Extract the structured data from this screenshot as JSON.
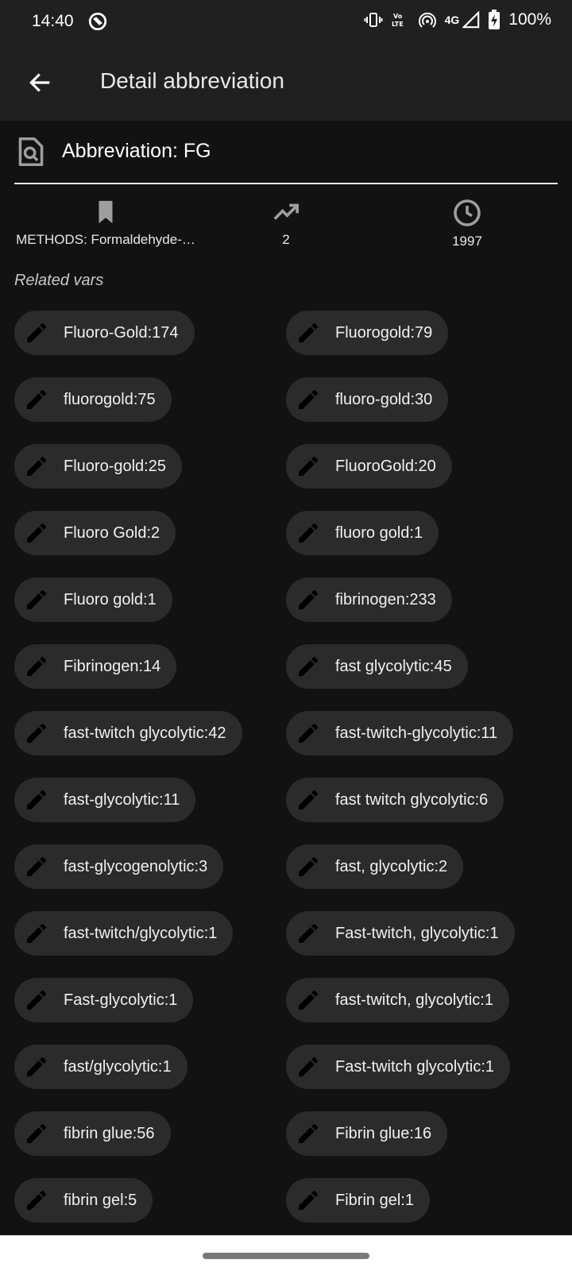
{
  "status_bar": {
    "time": "14:40",
    "network": "4G",
    "volte": "Vo LTE",
    "battery": "100%",
    "icons": [
      "app-notification-icon",
      "vibrate-icon",
      "volte-icon",
      "hotspot-icon",
      "signal-icon",
      "battery-charging-icon"
    ]
  },
  "app_bar": {
    "title": "Detail abbreviation",
    "back_icon": "arrow-left-icon"
  },
  "abbreviation": {
    "label": "Abbreviation: FG",
    "icon": "find-in-page-icon"
  },
  "stats": {
    "category": "METHODS: Formaldehyde-…",
    "category_icon": "bookmark-icon",
    "trend": "2",
    "trend_icon": "trending-up-icon",
    "year": "1997",
    "year_icon": "clock-icon"
  },
  "related": {
    "label": "Related vars",
    "chip_icon": "pencil-icon",
    "items": [
      "Fluoro-Gold:174",
      "Fluorogold:79",
      "fluorogold:75",
      "fluoro-gold:30",
      "Fluoro-gold:25",
      "FluoroGold:20",
      "Fluoro Gold:2",
      "fluoro gold:1",
      "Fluoro gold:1",
      "fibrinogen:233",
      "Fibrinogen:14",
      "fast glycolytic:45",
      "fast-twitch glycolytic:42",
      "fast-twitch-glycolytic:11",
      "fast-glycolytic:11",
      "fast twitch glycolytic:6",
      "fast-glycogenolytic:3",
      "fast, glycolytic:2",
      "fast-twitch/glycolytic:1",
      "Fast-twitch, glycolytic:1",
      "Fast-glycolytic:1",
      "fast-twitch, glycolytic:1",
      "fast/glycolytic:1",
      "Fast-twitch glycolytic:1",
      "fibrin glue:56",
      "Fibrin glue:16",
      "fibrin gel:5",
      "Fibrin gel:1"
    ]
  },
  "colors": {
    "background": "#121212",
    "app_bar": "#202020",
    "chip": "#2b2b2b",
    "text": "#ffffff",
    "icon": "#9e9e9e"
  }
}
